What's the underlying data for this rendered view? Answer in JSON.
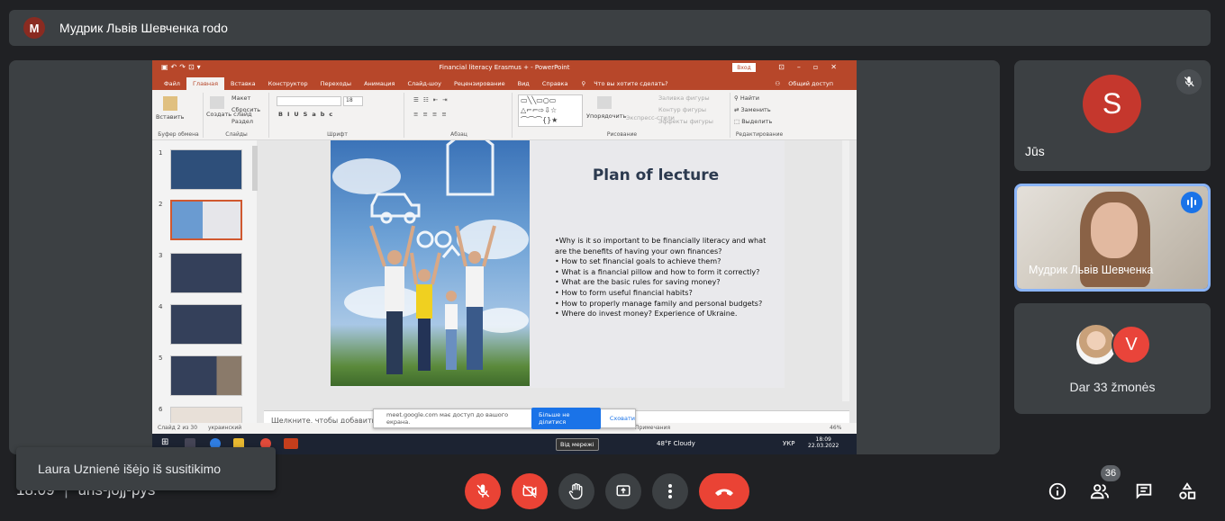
{
  "meeting": {
    "presenter_initial": "M",
    "presenter_title": "Мудрик Львів Шевченка rodo",
    "clock": "18:09",
    "code": "uns-jojj-pys",
    "toast": "Laura Uznienė išėjo iš susitikimo",
    "participants_count": "36"
  },
  "tiles": {
    "self": {
      "initial": "S",
      "label": "Jūs"
    },
    "speaker": {
      "label": "Мудрик Львів Шевченка"
    },
    "more": {
      "initial": "V",
      "label": "Dar 33 žmonės"
    }
  },
  "powerpoint": {
    "doc_title": "Financial literacy Erasmus + - PowerPoint",
    "login": "Вход",
    "tabs": [
      "Файл",
      "Главная",
      "Вставка",
      "Конструктор",
      "Переходы",
      "Анимация",
      "Слайд-шоу",
      "Рецензирование",
      "Вид",
      "Справка"
    ],
    "help_search": "Что вы хотите сделать?",
    "share": "Общий доступ",
    "ribbon": {
      "paste": "Вставить",
      "clipboard": "Буфер обмена",
      "create_slide": "Создать слайд",
      "layout": "Макет",
      "reset": "Сбросить",
      "section": "Раздел",
      "slides": "Слайды",
      "font": "Шрифт",
      "paragraph": "Абзац",
      "arrange": "Упорядочить",
      "quick_styles": "Экспресс-стили",
      "fill": "Заливка фигуры",
      "outline": "Контур фигуры",
      "effects": "Эффекты фигуры",
      "drawing": "Рисование",
      "find": "Найти",
      "replace": "Заменить",
      "select": "Выделить",
      "editing": "Редактирование",
      "font_size": "18"
    },
    "thumbnails": [
      "1",
      "2",
      "3",
      "4",
      "5",
      "6"
    ],
    "slide": {
      "title": "Plan of lecture",
      "bullets": [
        "•Why is it so important to be financially literacy and what are the benefits of having your own finances?",
        "• How to set financial goals to achieve them?",
        "• What is a financial pillow and how to form it correctly?",
        "• What are the basic rules for saving money?",
        "• How to form useful financial habits?",
        "• How to properly manage family and personal budgets?",
        "• Where do invest money? Experience of Ukraine."
      ]
    },
    "notes_placeholder": "Щелкните, чтобы добавить за",
    "status_left": "Слайд 2 из 30",
    "status_lang": "украинский",
    "status_notes": "Примечания",
    "status_zoom": "46%",
    "share_msg": "meet.google.com має доступ до вашого екрана.",
    "share_stop": "Більше не ділитися",
    "share_hide": "Сховати",
    "hint": "Від мережі",
    "weather": "48°F  Cloudy",
    "lang": "УКР",
    "time": "18:09",
    "date": "22.03.2022"
  }
}
